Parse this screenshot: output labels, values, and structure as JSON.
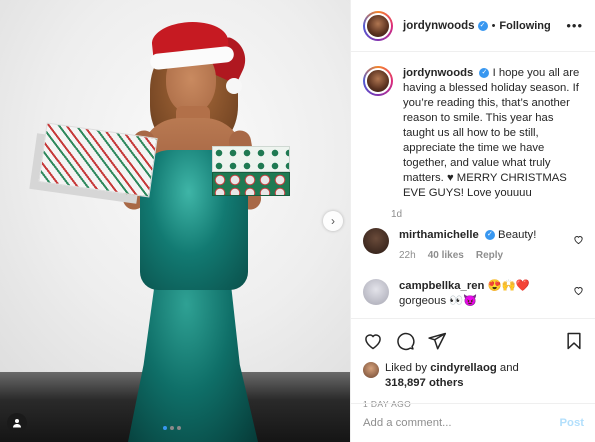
{
  "post": {
    "user": "jordynwoods",
    "verified_mark": "✓",
    "follow_state": "Following",
    "dot": "•",
    "more": "•••",
    "caption": "I hope you all are having a blessed holiday season. If you’re reading this, that’s another reason to smile. This year has taught us all how to be still, appreciate the time we have together, and value what truly matters. ♥ MERRY CHRISTMAS EVE GUYS! Love youuuu",
    "caption_age": "1d"
  },
  "comments": [
    {
      "user": "mirthamichelle",
      "verified": true,
      "text": "Beauty!",
      "age": "22h",
      "likes": "40 likes",
      "reply": "Reply",
      "avatar_color": "#3a2a22"
    },
    {
      "user": "campbellka_ren",
      "verified": false,
      "emoji": "😍🙌❤️",
      "text": "gorgeous 👀😈",
      "avatar_color": "#c8c8d0"
    }
  ],
  "likes": {
    "prefix": "Liked by",
    "user": "cindyrellaog",
    "conj": "and",
    "count": "318,897 others"
  },
  "post_date": "1 DAY AGO",
  "add_comment": {
    "placeholder": "Add a comment...",
    "post_label": "Post"
  },
  "carousel": {
    "slides": 3,
    "active": 0,
    "next_glyph": "›"
  },
  "colors": {
    "accent": "#3897f0",
    "muted": "#8e8e8e",
    "post_disabled": "#b2dffc"
  },
  "icons": [
    "heart-icon",
    "comment-icon",
    "share-icon",
    "bookmark-icon",
    "more-icon",
    "chevron-right-icon",
    "verified-icon"
  ]
}
